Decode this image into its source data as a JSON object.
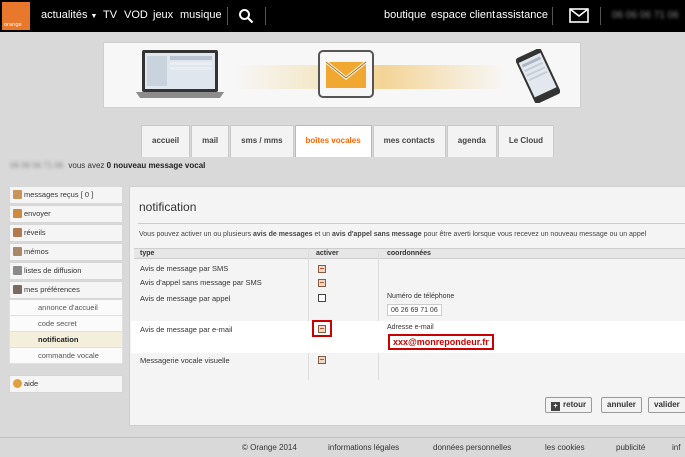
{
  "topnav": {
    "logo_text": "orange",
    "actualites": "actualités",
    "tv": "TV",
    "vod": "VOD",
    "jeux": "jeux",
    "musique": "musique",
    "boutique": "boutique",
    "espace_client": "espace client",
    "assistance": "assistance",
    "phone_blurred": "06 06 06 71 06"
  },
  "tabs": [
    "accueil",
    "mail",
    "sms / mms",
    "boîtes vocales",
    "mes contacts",
    "agenda",
    "Le Cloud"
  ],
  "greeting": {
    "number_blurred": "06 06 06 71 06",
    "prefix": "vous avez",
    "count_text": "0 nouveau message vocal"
  },
  "sidebar": {
    "messages_recus": "messages reçus [ 0 ]",
    "envoyer": "envoyer",
    "reveils": "réveils",
    "memos": "mémos",
    "listes": "listes de diffusion",
    "preferences": "mes préférences",
    "sub": [
      "annonce d'accueil",
      "code secret",
      "notification",
      "commande vocale"
    ],
    "aide": "aide"
  },
  "main": {
    "title": "notification",
    "intro_a": "Vous pouvez activer un ou plusieurs ",
    "intro_b": "avis de messages",
    "intro_c": " et un ",
    "intro_d": "avis d'appel sans message",
    "intro_e": " pour être averti lorsque vous recevez un nouveau message ou un appel",
    "col_type": "type",
    "col_activer": "activer",
    "col_coord": "coordonnées",
    "rows": {
      "sms": "Avis de message par SMS",
      "appel_sans_msg": "Avis d'appel sans message par SMS",
      "appel": "Avis de message par appel",
      "email": "Avis de message par e-mail",
      "visuelle": "Messagerie vocale visuelle"
    },
    "tel_label": "Numéro de téléphone",
    "tel_value": "06 26 69 71 06",
    "email_label": "Adresse e-mail",
    "email_value": "xxx@monrepondeur.fr",
    "btn_retour": "retour",
    "btn_annuler": "annuler",
    "btn_valider": "valider"
  },
  "footer": {
    "copyright": "© Orange 2014",
    "legal": "informations légales",
    "donnees": "données personnelles",
    "cookies": "les cookies",
    "publicite": "publicité",
    "more": "inf"
  },
  "checkboxes": {
    "sms": true,
    "appel_sans_msg": true,
    "appel": false,
    "email": true,
    "visuelle": true
  },
  "colors": {
    "brand": "#ff6600",
    "highlight": "#cc0000"
  }
}
